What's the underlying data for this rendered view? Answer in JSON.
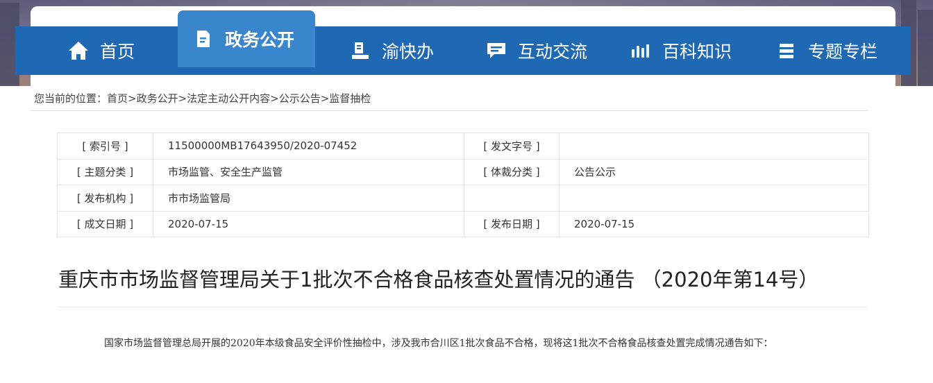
{
  "nav": {
    "items": [
      {
        "label": "首页",
        "icon": "home-icon"
      },
      {
        "label": "政务公开",
        "icon": "document-icon"
      },
      {
        "label": "渝快办",
        "icon": "bookstand-icon"
      },
      {
        "label": "互动交流",
        "icon": "chat-icon"
      },
      {
        "label": "百科知识",
        "icon": "bars-icon"
      },
      {
        "label": "专题专栏",
        "icon": "stack-icon"
      }
    ],
    "active": "政务公开"
  },
  "breadcrumb": {
    "text": "您当前的位置：首页>政务公开>法定主动公开内容>公示公告>监督抽检"
  },
  "info": {
    "rows": [
      {
        "label1": "[ 索引号 ]",
        "value1": "11500000MB17643950/2020-07452",
        "label2": "[ 发文字号 ]",
        "value2": ""
      },
      {
        "label1": "[ 主题分类 ]",
        "value1": "市场监管、安全生产监管",
        "label2": "[ 体裁分类 ]",
        "value2": "公告公示"
      },
      {
        "label1": "[ 发布机构 ]",
        "value1": "市市场监管局",
        "label2": "",
        "value2": ""
      },
      {
        "label1": "[ 成文日期 ]",
        "value1": "2020-07-15",
        "label2": "[ 发布日期 ]",
        "value2": "2020-07-15"
      }
    ]
  },
  "article": {
    "title": "重庆市市场监督管理局关于1批次不合格食品核查处置情况的通告 （2020年第14号）",
    "paragraph": "国家市场监督管理总局开展的2020年本级食品安全评价性抽检中，涉及我市合川区1批次食品不合格，现将这1批次不合格食品核查处置完成情况通告如下："
  },
  "colors": {
    "nav_bg": "#1f69b4",
    "nav_active": "#3a86cc"
  }
}
